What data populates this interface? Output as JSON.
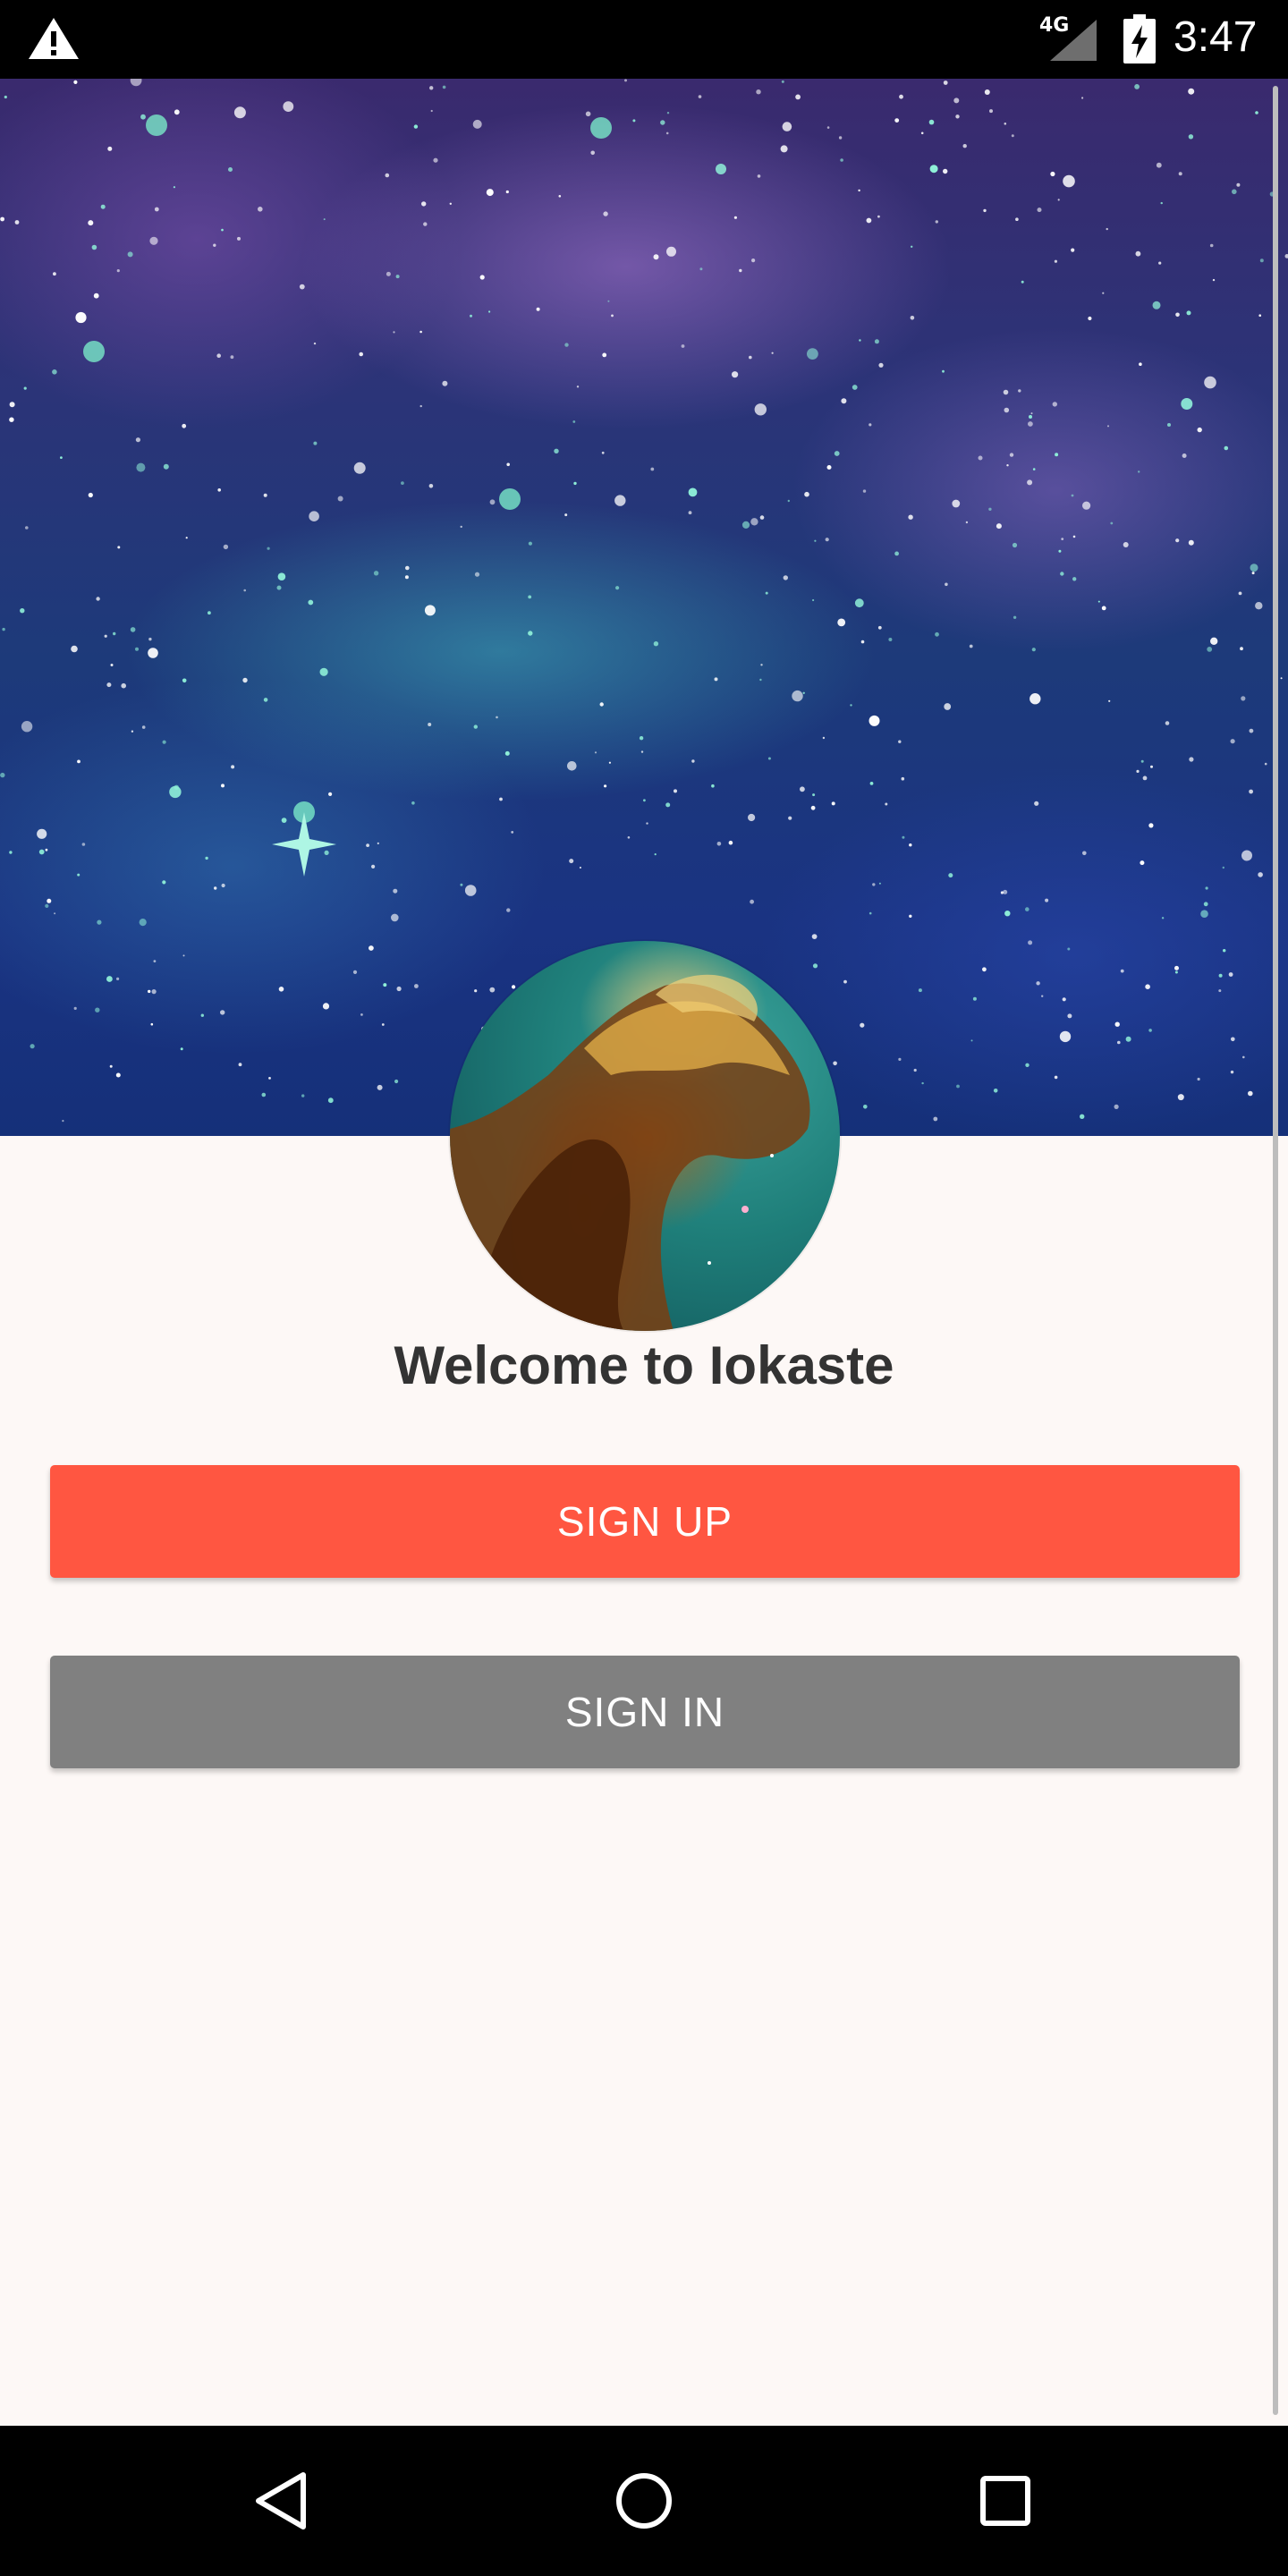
{
  "status_bar": {
    "network_type": "4G",
    "time": "3:47",
    "icons": [
      "warning-icon",
      "signal-icon",
      "battery-charging-icon"
    ]
  },
  "header": {
    "image": "starry-space-background"
  },
  "profile": {
    "avatar": "nebula-avatar"
  },
  "welcome": {
    "title": "Welcome to Iokaste"
  },
  "actions": {
    "sign_up_label": "SIGN UP",
    "sign_in_label": "SIGN IN",
    "sign_up_color": "#ff5641",
    "sign_in_color": "#808080"
  },
  "nav_bar": {
    "icons": [
      "back-icon",
      "home-icon",
      "recents-icon"
    ]
  }
}
